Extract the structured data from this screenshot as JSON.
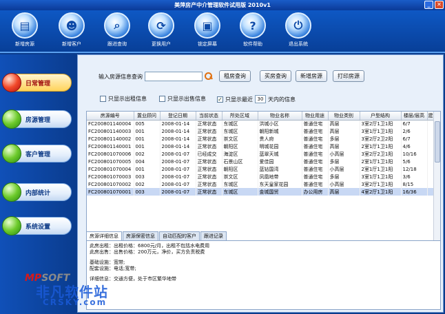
{
  "window": {
    "title": "美萍房产中介管理软件试用版 2010v1"
  },
  "toolbar": {
    "items": [
      {
        "label": "新增房源",
        "icon": "doc-icon",
        "glyph": "▤"
      },
      {
        "label": "新增客户",
        "icon": "user-icon",
        "glyph": "☻"
      },
      {
        "label": "跟进查询",
        "icon": "search-icon",
        "glyph": "⌕"
      },
      {
        "label": "更换用户",
        "icon": "refresh-icon",
        "glyph": "⟳"
      },
      {
        "label": "锁定屏幕",
        "icon": "lock-screen-icon",
        "glyph": "▣"
      },
      {
        "label": "软件帮助",
        "icon": "help-icon",
        "glyph": "?"
      },
      {
        "label": "退出系统",
        "icon": "power-icon",
        "glyph": "⏻"
      }
    ]
  },
  "sidebar": {
    "items": [
      {
        "label": "日常管理",
        "active": true
      },
      {
        "label": "房源管理",
        "active": false
      },
      {
        "label": "客户管理",
        "active": false
      },
      {
        "label": "内部统计",
        "active": false
      },
      {
        "label": "系统设置",
        "active": false
      }
    ]
  },
  "search": {
    "label": "输入房源信息查询",
    "value": ""
  },
  "buttons": {
    "rent_query": "租房查询",
    "buy_query": "买房查询",
    "add_listing": "新增房源",
    "print_listing": "打印房源"
  },
  "filters": {
    "rent_only": "只显示出租信息",
    "sale_only": "只显示出售信息",
    "recent_prefix": "只显示最近",
    "recent_days": "30",
    "recent_suffix": "天内的信息"
  },
  "table": {
    "columns": [
      "房源编号",
      "置业顾问",
      "登记日期",
      "当前状态",
      "所处区域",
      "物业名称",
      "物业用途",
      "物业类别",
      "户型结构",
      "楼层/层高",
      "建"
    ],
    "rows": [
      [
        "FC200801140004",
        "005",
        "2008-01-14",
        "正常状态",
        "东城区",
        "洪城小区",
        "普通住宅",
        "高层",
        "3室2厅1卫1阳",
        "6/7",
        ""
      ],
      [
        "FC200801140003",
        "001",
        "2008-01-14",
        "正常状态",
        "东城区",
        "朝阳新城",
        "普通住宅",
        "高层",
        "3室1厅1卫1阳",
        "2/6",
        ""
      ],
      [
        "FC200801140002",
        "001",
        "2008-01-14",
        "正常状态",
        "崇文区",
        "贵人府",
        "普通住宅",
        "多层",
        "3室2厅2卫2阳",
        "6/7",
        ""
      ],
      [
        "FC200801140001",
        "001",
        "2008-01-14",
        "正常状态",
        "朝阳区",
        "明城花园",
        "普通住宅",
        "高层",
        "2室1厅1卫1阳",
        "4/6",
        ""
      ],
      [
        "FC200801070006",
        "002",
        "2008-01-07",
        "已经成交",
        "海淀区",
        "蓝翠天城",
        "普通住宅",
        "小高层",
        "3室2厅2卫1阳",
        "10/16",
        ""
      ],
      [
        "FC200801070005",
        "004",
        "2008-01-07",
        "正常状态",
        "石景山区",
        "爱佳园",
        "普通住宅",
        "多层",
        "2室1厅1卫1阳",
        "5/6",
        ""
      ],
      [
        "FC200801070004",
        "001",
        "2008-01-07",
        "正常状态",
        "朝阳区",
        "蓝钻国湾",
        "普通住宅",
        "小高层",
        "2室1厅1卫1阳",
        "12/18",
        ""
      ],
      [
        "FC200801070003",
        "003",
        "2008-01-07",
        "正常状态",
        "崇文区",
        "凤凰地带",
        "普通住宅",
        "多层",
        "3室1厅1卫1阳",
        "3/6",
        ""
      ],
      [
        "FC200801070002",
        "002",
        "2008-01-07",
        "正常状态",
        "东城区",
        "东天皇家花园",
        "普通住宅",
        "小高层",
        "3室2厅1卫1阳",
        "8/15",
        ""
      ],
      [
        "FC200801070001",
        "003",
        "2008-01-07",
        "正常状态",
        "东城区",
        "金城国贸",
        "办公用房",
        "高层",
        "4室2厅1卫1阳",
        "16/36",
        ""
      ]
    ],
    "selected_index": 9
  },
  "tabs": [
    "房源详细信息",
    "房源保密信息",
    "自动匹配的客户",
    "跟进记录"
  ],
  "detail": {
    "line1": "此房出租：出租价格：6800元/月，出租不包括水电费用",
    "line2": "此房出售：出售价格：200万元，净价，买方负责税费",
    "line3": "基础设施：宽带;",
    "line4": "配套设施：电话;宽带;",
    "line5": "详细信息：交通方便，处于市区繁华地带"
  },
  "watermark": {
    "logo_red": "MP",
    "logo_grey": "SOFT",
    "site": "非凡软件站",
    "url": "CRSKY.com"
  }
}
